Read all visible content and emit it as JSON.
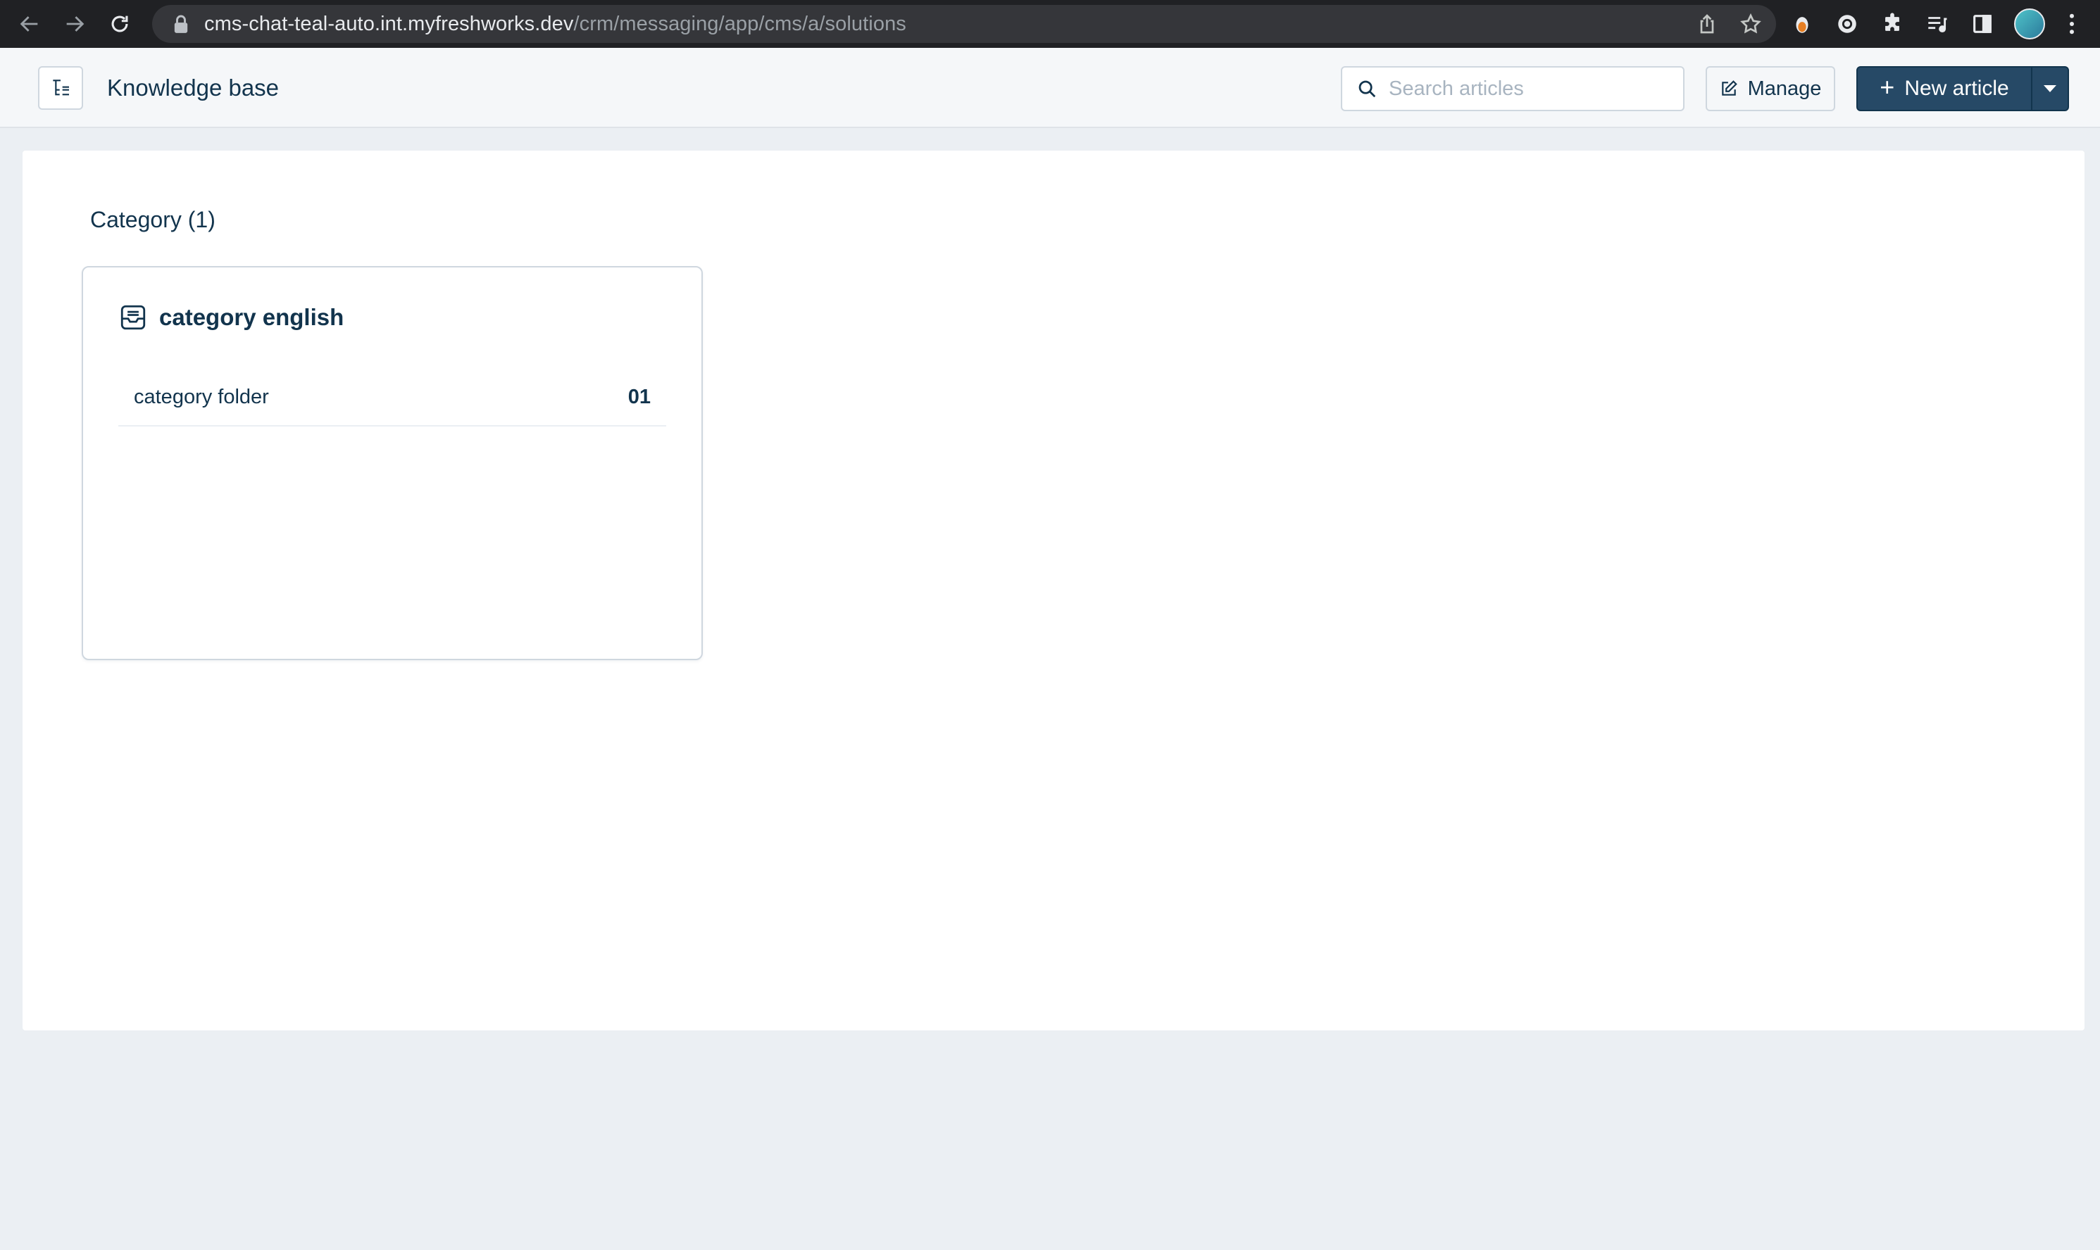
{
  "browser": {
    "url_host": "cms-chat-teal-auto.int.myfreshworks.dev",
    "url_path": "/crm/messaging/app/cms/a/solutions"
  },
  "header": {
    "title": "Knowledge base",
    "search_placeholder": "Search articles",
    "manage_label": "Manage",
    "new_article_label": "New article"
  },
  "main": {
    "section_title": "Category (1)",
    "categories": [
      {
        "name": "category english",
        "folders": [
          {
            "name": "category folder",
            "count": "01"
          }
        ]
      }
    ]
  },
  "colors": {
    "primary": "#264966",
    "text": "#12344d",
    "border": "#cfd7df",
    "page_bg": "#ebeff3"
  }
}
